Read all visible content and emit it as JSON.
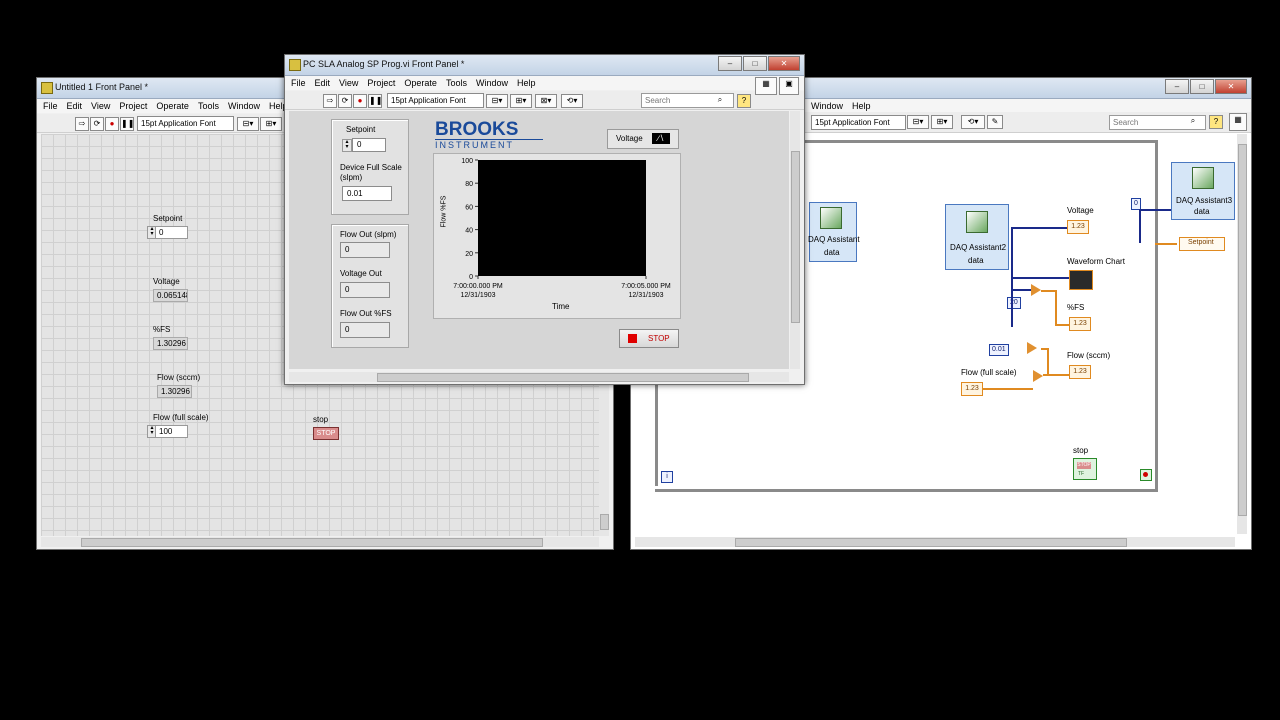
{
  "fp1": {
    "title": "Untitled 1 Front Panel *",
    "menu": [
      "File",
      "Edit",
      "View",
      "Project",
      "Operate",
      "Tools",
      "Window",
      "Help"
    ],
    "font": "15pt Application Font",
    "setpoint_label": "Setpoint",
    "setpoint_value": "0",
    "voltage_label": "Voltage",
    "voltage_value": "0.065148",
    "pfs_label": "%FS",
    "pfs_value": "1.30296",
    "flow_sccm_label": "Flow (sccm)",
    "flow_sccm_value": "1.30296",
    "flow_fs_label": "Flow (full scale)",
    "flow_fs_value": "100",
    "stop_label": "stop",
    "stop_btn": "STOP"
  },
  "vi": {
    "title": "PC SLA Analog SP Prog.vi Front Panel *",
    "menu": [
      "File",
      "Edit",
      "View",
      "Project",
      "Operate",
      "Tools",
      "Window",
      "Help"
    ],
    "font": "15pt Application Font",
    "search_placeholder": "Search",
    "setpoint_label": "Setpoint",
    "setpoint_value": "0",
    "fullscale_label_1": "Device Full Scale",
    "fullscale_label_2": "(slpm)",
    "fullscale_value": "0.01",
    "flow_out_label": "Flow Out (slpm)",
    "flow_out_value": "0",
    "voltage_out_label": "Voltage Out",
    "voltage_out_value": "0",
    "flow_pfs_label": "Flow Out %FS",
    "flow_pfs_value": "0",
    "brand_line1": "BROOKS",
    "brand_line2": "INSTRUMENT",
    "legend_label": "Voltage",
    "stop_label": "STOP"
  },
  "chart_data": {
    "type": "line",
    "title": "",
    "xlabel": "Time",
    "ylabel": "Flow %FS",
    "ylim": [
      0,
      100
    ],
    "y_ticks": [
      "100",
      "80",
      "60",
      "40",
      "20",
      "0"
    ],
    "x_ticks": [
      {
        "time": "7:00:00.000 PM",
        "date": "12/31/1903"
      },
      {
        "time": "7:00:05.000 PM",
        "date": "12/31/1903"
      }
    ],
    "series": [
      {
        "name": "Voltage",
        "values": []
      }
    ],
    "plot_bg": "#000000"
  },
  "bd": {
    "menu": [
      "Window",
      "Help"
    ],
    "font": "15pt Application Font",
    "search_placeholder": "Search",
    "daq1": "DAQ Assistant",
    "daq1_term": "data",
    "daq2": "DAQ Assistant2",
    "daq2_term": "data",
    "daq3": "DAQ Assistant3",
    "daq3_term": "data",
    "voltage": "Voltage",
    "waveform": "Waveform Chart",
    "pfs": "%FS",
    "flow_sccm": "Flow (sccm)",
    "flow_fs": "Flow (full scale)",
    "stop": "stop",
    "setpoint": "Setpoint",
    "const_20": "20",
    "const_001": "0.01",
    "const_0": "0",
    "iter": "i",
    "ind_glyph": "1.23",
    "stop_glyph": "STOP",
    "stop_glyph2": "TF"
  },
  "colors": {
    "wire_blue": "#1a2a8a",
    "wire_orange": "#e08a20",
    "stop_red": "#d00000"
  }
}
